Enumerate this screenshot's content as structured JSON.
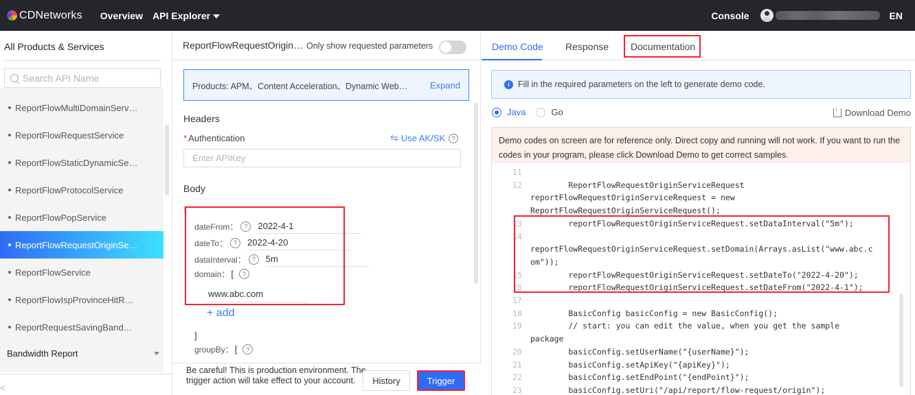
{
  "topnav": {
    "brand": "CDNetworks",
    "links": [
      "Overview",
      "API Explorer"
    ],
    "console": "Console",
    "language": "EN"
  },
  "sidebar": {
    "title": "All Products & Services",
    "search_placeholder": "Search API Name",
    "items": [
      {
        "label": "ReportFlowMultiDomainServ…",
        "active": false
      },
      {
        "label": "ReportFlowRequestService",
        "active": false
      },
      {
        "label": "ReportFlowStaticDynamicSe…",
        "active": false
      },
      {
        "label": "ReportFlowProtocolService",
        "active": false
      },
      {
        "label": "ReportFlowPopService",
        "active": false
      },
      {
        "label": "ReportFlowRequestOriginSe…",
        "active": true
      },
      {
        "label": "ReportFlowService",
        "active": false
      },
      {
        "label": "ReportFlowIspProvinceHitR…",
        "active": false
      },
      {
        "label": "ReportRequestSavingBand…",
        "active": false
      }
    ],
    "category": "Bandwidth Report",
    "collapse_glyph": "<"
  },
  "middle": {
    "api_title": "ReportFlowRequestOrigin…",
    "only_show_label": "Only show requested parameters",
    "only_show_enabled": false,
    "products_text": "Products: APM、Content Acceleration、Dynamic Web…",
    "expand_label": "Expand",
    "headers_label": "Headers",
    "auth_required_mark": "*",
    "auth_label": "Authentication",
    "use_aksk_label": "Use AK/SK",
    "apikey_placeholder": "Enter APIKey",
    "body_label": "Body",
    "open_brace": "{",
    "params": {
      "dateFrom": {
        "label": "dateFrom：",
        "value": "2022-4-1"
      },
      "dateTo": {
        "label": "dateTo：",
        "value": "2022-4-20"
      },
      "dataInterval": {
        "label": "dataInterval：",
        "value": "5m"
      },
      "domain": {
        "label": "domain：",
        "bracket": "[",
        "items": [
          "www.abc.com"
        ]
      },
      "groupBy": {
        "label": "groupBy：",
        "bracket": "["
      }
    },
    "add_label": "+ add",
    "close_bracket": "]",
    "help_glyph": "?",
    "warning": "Be careful! This is production environment. The trigger action will take effect to your account.",
    "history_label": "History",
    "trigger_label": "Trigger"
  },
  "right": {
    "tabs": [
      {
        "label": "Demo Code",
        "active": true
      },
      {
        "label": "Response",
        "active": false
      },
      {
        "label": "Documentation",
        "active": false
      }
    ],
    "info_text": "Fill in the required parameters on the left to generate demo code.",
    "languages": [
      {
        "label": "Java",
        "checked": true
      },
      {
        "label": "Go",
        "checked": false
      }
    ],
    "download_label": "Download Demo",
    "code_warning": "Demo codes on screen are for reference only. Direct copy and running will not work. If you want to run the codes in your program, please click Download Demo to get correct samples.",
    "code_lines": [
      {
        "no": "11",
        "text": ""
      },
      {
        "no": "12",
        "text": "        ReportFlowRequestOriginServiceRequest"
      },
      {
        "no": "",
        "text": "reportFlowRequestOriginServiceRequest = new",
        "wrap": true
      },
      {
        "no": "",
        "text": "ReportFlowRequestOriginServiceRequest();",
        "wrap": true
      },
      {
        "no": "13",
        "text": "        reportFlowRequestOriginServiceRequest.setDataInterval(\"5m\");"
      },
      {
        "no": "14",
        "text": ""
      },
      {
        "no": "",
        "text": "reportFlowRequestOriginServiceRequest.setDomain(Arrays.asList(\"www.abc.c",
        "wrap": true
      },
      {
        "no": "",
        "text": "om\"));",
        "wrap": true
      },
      {
        "no": "15",
        "text": "        reportFlowRequestOriginServiceRequest.setDateTo(\"2022-4-20\");"
      },
      {
        "no": "16",
        "text": "        reportFlowRequestOriginServiceRequest.setDateFrom(\"2022-4-1\");"
      },
      {
        "no": "17",
        "text": ""
      },
      {
        "no": "18",
        "text": "        BasicConfig basicConfig = new BasicConfig();"
      },
      {
        "no": "19",
        "text": "        // start: you can edit the value, when you get the sample"
      },
      {
        "no": "",
        "text": "package",
        "wrap": true
      },
      {
        "no": "20",
        "text": "        basicConfig.setUserName(\"{userName}\");"
      },
      {
        "no": "21",
        "text": "        basicConfig.setApiKey(\"{apiKey}\");"
      },
      {
        "no": "22",
        "text": "        basicConfig.setEndPoint(\"{endPoint}\");"
      },
      {
        "no": "23",
        "text": "        basicConfig.setUri(\"/api/report/flow-request/origin\");"
      }
    ]
  },
  "colors": {
    "nav_bg": "#25262b",
    "accent": "#2f6cf6",
    "highlight": "#f5222d",
    "active_gradient_end": "#3fe0ff"
  }
}
